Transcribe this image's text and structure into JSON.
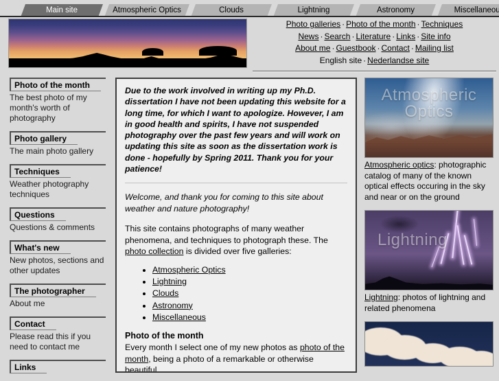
{
  "tabs": [
    {
      "label": "Main site",
      "active": true
    },
    {
      "label": "Atmospheric Optics",
      "active": false
    },
    {
      "label": "Clouds",
      "active": false
    },
    {
      "label": "Lightning",
      "active": false
    },
    {
      "label": "Astronomy",
      "active": false
    },
    {
      "label": "Miscellaneous",
      "active": false
    }
  ],
  "header": {
    "nav_rows": [
      {
        "items": [
          {
            "label": "Photo galleries",
            "link": true
          },
          {
            "label": "Photo of the month",
            "link": true
          },
          {
            "label": "Techniques",
            "link": true
          }
        ]
      },
      {
        "items": [
          {
            "label": "News",
            "link": true
          },
          {
            "label": "Search",
            "link": true
          },
          {
            "label": "Literature",
            "link": true
          },
          {
            "label": "Links",
            "link": true
          },
          {
            "label": "Site info",
            "link": true
          }
        ]
      },
      {
        "items": [
          {
            "label": "About me",
            "link": true
          },
          {
            "label": "Guestbook",
            "link": true
          },
          {
            "label": "Contact",
            "link": true
          },
          {
            "label": "Mailing list",
            "link": true
          }
        ]
      },
      {
        "items": [
          {
            "label": "English site",
            "link": false
          },
          {
            "label": "Nederlandse site",
            "link": true
          }
        ]
      }
    ],
    "separator": "·",
    "banner_alt": "twilight panorama with mountain silhouette"
  },
  "sidebar": {
    "items": [
      {
        "title": "Photo of the month",
        "desc": "The best photo of my month's worth of photography"
      },
      {
        "title": "Photo gallery",
        "desc": "The main photo gallery"
      },
      {
        "title": "Techniques",
        "desc": "Weather photography techniques"
      },
      {
        "title": "Questions",
        "desc": "Questions & comments"
      },
      {
        "title": "What's new",
        "desc": "New photos, sections and other updates"
      },
      {
        "title": "The photographer",
        "desc": "About me"
      },
      {
        "title": "Contact",
        "desc": "Please read this if you need to contact me"
      },
      {
        "title": "Links",
        "desc": ""
      }
    ]
  },
  "main": {
    "notice": "Due to the work involved in writing up my Ph.D. dissertation I have not been updating this website for a long time, for which I want to apologize. However, I am in good health and spirits, I have not suspended photography over the past few years and will work on updating this site as soon as the dissertation work is done - hopefully by Spring 2011. Thank you for your patience!",
    "welcome": "Welcome, and thank you for coming to this site about weather and nature photography!",
    "intro_part1": "This site contains photographs of many weather phenomena, and techniques to photograph these. The ",
    "intro_link": "photo collection",
    "intro_part2": " is divided over five galleries:",
    "galleries": [
      "Atmospheric Optics",
      "Lightning",
      "Clouds",
      "Astronomy",
      "Miscellaneous"
    ],
    "potm_heading": "Photo of the month",
    "potm_part1": "Every month I select one of my new photos as ",
    "potm_link": "photo of the month",
    "potm_part2": ", being a photo of a remarkable or otherwise beautiful"
  },
  "rightcol": {
    "cards": [
      {
        "overlay_line1": "Atmospheric",
        "overlay_line2": "Optics",
        "caption_link": "Atmospheric optics",
        "caption_rest": ": photographic catalog of many of the known optical effects occuring in the sky and near or on the ground"
      },
      {
        "overlay_line1": "Lightning",
        "overlay_line2": "",
        "caption_link": "Lightning",
        "caption_rest": ": photos of lightning and related phenomena"
      },
      {
        "overlay_line1": "",
        "overlay_line2": "",
        "caption_link": "",
        "caption_rest": ""
      }
    ]
  },
  "colors": {
    "page_bg": "#d9d9d9",
    "main_bg": "#efefef",
    "tab_inactive": "#b4b4b4",
    "tab_active": "#6e6e6e",
    "border_dark": "#3b3b3b"
  }
}
